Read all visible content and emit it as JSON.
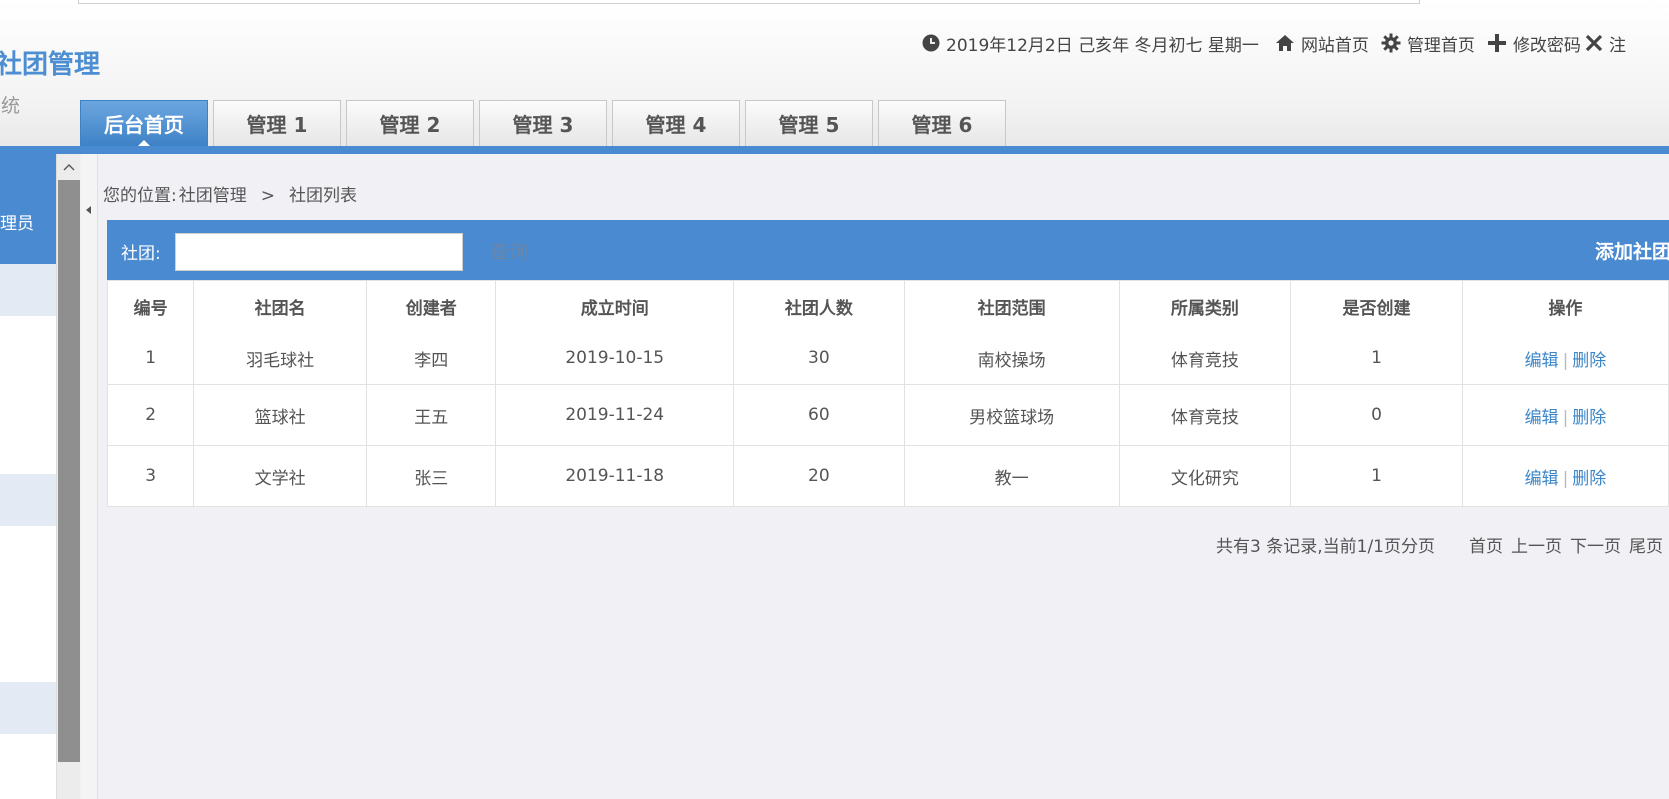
{
  "header": {
    "title": "社团管理",
    "subtitle": "系统",
    "datetime": "2019年12月2日 己亥年 冬月初七 星期一",
    "links": {
      "site_home": "网站首页",
      "admin_home": "管理首页",
      "change_password": "修改密码",
      "logout": "注"
    }
  },
  "tabs": [
    {
      "label": "后台首页",
      "active": true
    },
    {
      "label": "管理 1",
      "active": false
    },
    {
      "label": "管理 2",
      "active": false
    },
    {
      "label": "管理 3",
      "active": false
    },
    {
      "label": "管理 4",
      "active": false
    },
    {
      "label": "管理 5",
      "active": false
    },
    {
      "label": "管理 6",
      "active": false
    }
  ],
  "sidebar": {
    "active_item": "理员"
  },
  "breadcrumb": {
    "prefix": "您的位置:",
    "section": "社团管理",
    "separator": ">",
    "page": "社团列表"
  },
  "search": {
    "label": "社团:",
    "value": "",
    "query_label": "查询",
    "add_label": "添加社团"
  },
  "table": {
    "headers": [
      "编号",
      "社团名",
      "创建者",
      "成立时间",
      "社团人数",
      "社团范围",
      "所属类别",
      "是否创建",
      "操作"
    ],
    "rows": [
      {
        "id": "1",
        "name": "羽毛球社",
        "creator": "李四",
        "date": "2019-10-15",
        "members": "30",
        "scope": "南校操场",
        "category": "体育竞技",
        "created": "1",
        "edit": "编辑",
        "delete": "删除"
      },
      {
        "id": "2",
        "name": "篮球社",
        "creator": "王五",
        "date": "2019-11-24",
        "members": "60",
        "scope": "男校篮球场",
        "category": "体育竞技",
        "created": "0",
        "edit": "编辑",
        "delete": "删除"
      },
      {
        "id": "3",
        "name": "文学社",
        "creator": "张三",
        "date": "2019-11-18",
        "members": "20",
        "scope": "教一",
        "category": "文化研究",
        "created": "1",
        "edit": "编辑",
        "delete": "删除"
      }
    ]
  },
  "pager": {
    "summary": "共有3 条记录,当前1/1页分页",
    "first": "首页",
    "prev": "上一页",
    "next": "下一页",
    "last": "尾页"
  },
  "colors": {
    "accent": "#4a8ad0",
    "link": "#3b86c9",
    "brand": "#4c8ed1"
  }
}
